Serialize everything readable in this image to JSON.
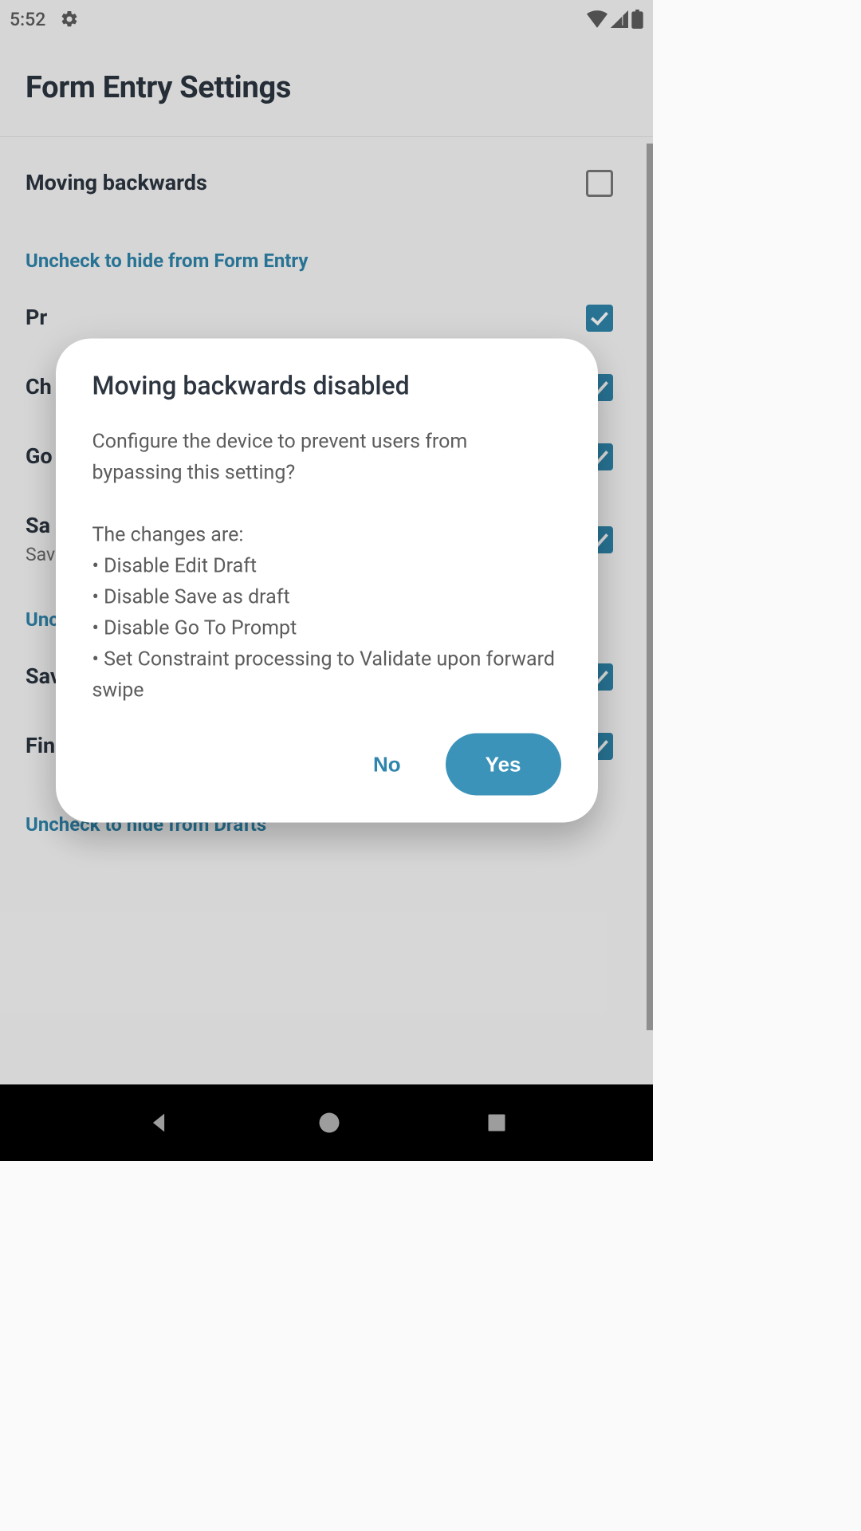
{
  "statusbar": {
    "time": "5:52"
  },
  "appbar": {
    "title": "Form Entry Settings"
  },
  "settings": {
    "moving_backwards": {
      "title": "Moving backwards",
      "checked": false
    },
    "section_form_entry": "Uncheck to hide from Form Entry",
    "row_pr": {
      "title": "Pr",
      "checked": true
    },
    "row_ch": {
      "title": "Ch",
      "checked": true
    },
    "row_go": {
      "title": "Go",
      "checked": true
    },
    "row_sa": {
      "title": "Sa",
      "sub": "Sav\nwh",
      "checked": true
    },
    "section_unc": "Unc",
    "save_as_draft": {
      "title": "Save as draft",
      "checked": true
    },
    "finalize": {
      "title": "Finalize",
      "checked": true
    },
    "section_drafts": "Uncheck to hide from Drafts"
  },
  "dialog": {
    "title": "Moving backwards disabled",
    "body": "Configure the device to prevent users from bypassing this setting?\n\nThe changes are:\n• Disable Edit Draft\n• Disable Save as draft\n• Disable Go To Prompt\n• Set Constraint processing to Validate upon forward swipe",
    "no": "No",
    "yes": "Yes"
  },
  "colors": {
    "accent": "#3c93ba",
    "link": "#2f86ad"
  }
}
